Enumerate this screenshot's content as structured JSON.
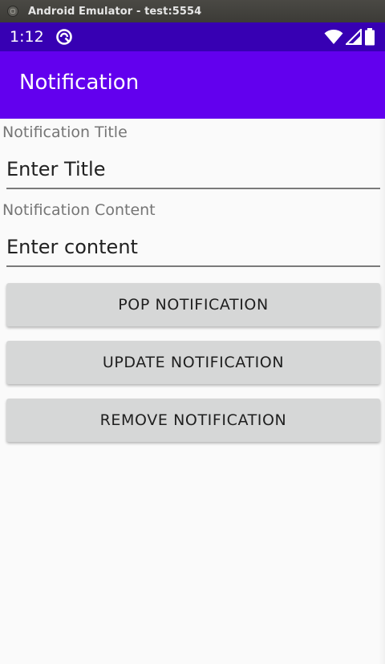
{
  "window": {
    "title": "Android Emulator - test:5554"
  },
  "status_bar": {
    "time": "1:12",
    "icons": [
      "app-notification-icon",
      "wifi-icon",
      "signal-icon",
      "battery-icon"
    ]
  },
  "app_bar": {
    "title": "Notification"
  },
  "form": {
    "title_label": "Notification Title",
    "title_placeholder": "Enter Title",
    "content_label": "Notification Content",
    "content_placeholder": "Enter content"
  },
  "buttons": {
    "pop": "POP NOTIFICATION",
    "update": "UPDATE NOTIFICATION",
    "remove": "REMOVE NOTIFICATION"
  },
  "colors": {
    "status_bar": "#3700b3",
    "app_bar": "#6200ee",
    "button_bg": "#d6d7d7",
    "background": "#fafafa"
  }
}
